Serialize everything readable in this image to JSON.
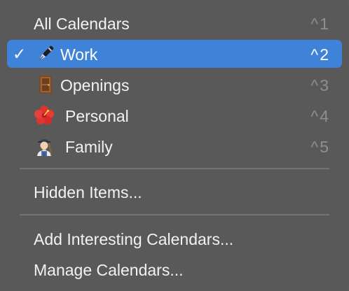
{
  "menu": {
    "items": [
      {
        "label": "All Calendars",
        "shortcut": "^1",
        "checked": false
      },
      {
        "label": "Work",
        "shortcut": "^2",
        "checked": true,
        "icon": "pen-icon"
      },
      {
        "label": "Openings",
        "shortcut": "^3",
        "checked": false,
        "icon": "door-icon"
      },
      {
        "label": "Personal",
        "shortcut": "^4",
        "checked": false,
        "icon": "hibiscus-icon"
      },
      {
        "label": "Family",
        "shortcut": "^5",
        "checked": false,
        "icon": "farmer-icon"
      }
    ],
    "check_glyph": "✓",
    "hidden_items": "Hidden Items...",
    "add_interesting": "Add Interesting Calendars...",
    "manage": "Manage Calendars..."
  },
  "colors": {
    "menu_background": "#59595a",
    "selected": "#3f83d9",
    "text": "#f2f2f2",
    "shortcut": "#8f8f90"
  }
}
